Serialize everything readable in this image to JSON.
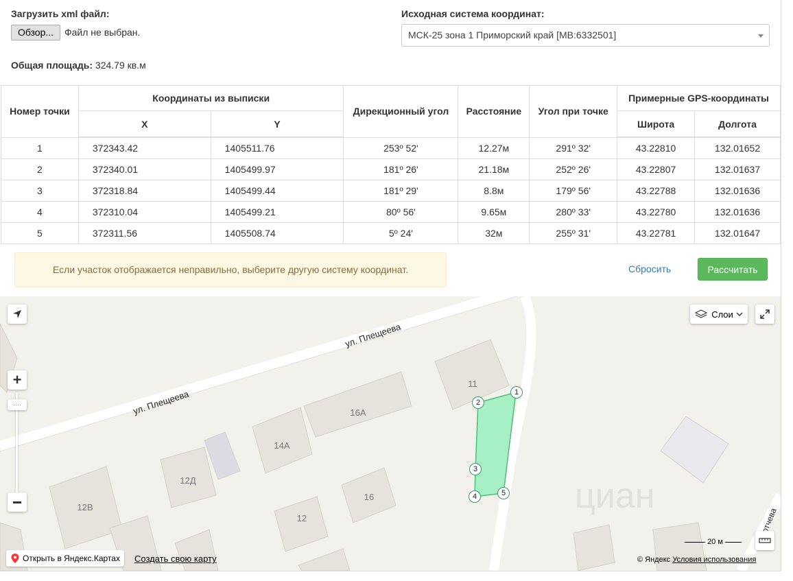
{
  "upload": {
    "label": "Загрузить xml файл:",
    "button": "Обзор...",
    "status": "Файл не выбран."
  },
  "total_area": {
    "label": "Общая площадь:",
    "value": "324.79 кв.м"
  },
  "coord_system": {
    "label": "Исходная система координат:",
    "selected": "МСК-25 зона 1 Приморский край [MB:6332501]"
  },
  "table": {
    "headers": {
      "point_num": "Номер точки",
      "coords": "Координаты из выписки",
      "x": "X",
      "y": "Y",
      "direction": "Дирекционный угол",
      "distance": "Расстояние",
      "angle": "Угол при точке",
      "gps": "Примерные GPS-координаты",
      "lat": "Широта",
      "lon": "Долгота"
    },
    "rows": [
      {
        "n": "1",
        "x": "372343.42",
        "y": "1405511.76",
        "dir": "253º 52'",
        "dist": "12.27м",
        "angle": "291º 32'",
        "lat": "43.22810",
        "lon": "132.01652"
      },
      {
        "n": "2",
        "x": "372340.01",
        "y": "1405499.97",
        "dir": "181º 26'",
        "dist": "21.18м",
        "angle": "252º 26'",
        "lat": "43.22807",
        "lon": "132.01637"
      },
      {
        "n": "3",
        "x": "372318.84",
        "y": "1405499.44",
        "dir": "181º 29'",
        "dist": "8.8м",
        "angle": "179º 56'",
        "lat": "43.22788",
        "lon": "132.01636"
      },
      {
        "n": "4",
        "x": "372310.04",
        "y": "1405499.21",
        "dir": "80º 56'",
        "dist": "9.65м",
        "angle": "280º 33'",
        "lat": "43.22780",
        "lon": "132.01636"
      },
      {
        "n": "5",
        "x": "372311.56",
        "y": "1405508.74",
        "dir": "5º 24'",
        "dist": "32м",
        "angle": "255º 31'",
        "lat": "43.22781",
        "lon": "132.01647"
      }
    ]
  },
  "alert": "Если участок отображается неправильно, выберите другую систему координат.",
  "actions": {
    "reset": "Сбросить",
    "calculate": "Рассчитать"
  },
  "map": {
    "layers_label": "Слои",
    "streets": [
      "ул. Плещеева",
      "ул. Плещеева",
      "ютчева"
    ],
    "buildings": [
      "11",
      "16А",
      "14А",
      "12Д",
      "12В",
      "16",
      "12"
    ],
    "points": [
      "1",
      "2",
      "3",
      "4",
      "5"
    ],
    "watermark": "циан",
    "scale": "20 м",
    "open_yandex": "Открыть в Яндекс.Картах",
    "create_map": "Создать свою карту",
    "copyright": "© Яндекс",
    "terms": "Условия использования"
  },
  "colors": {
    "calc_button": "#5cb85c",
    "link": "#337ab7",
    "alert_bg": "#fcf8e3",
    "plot_fill": "#a7efc4"
  }
}
